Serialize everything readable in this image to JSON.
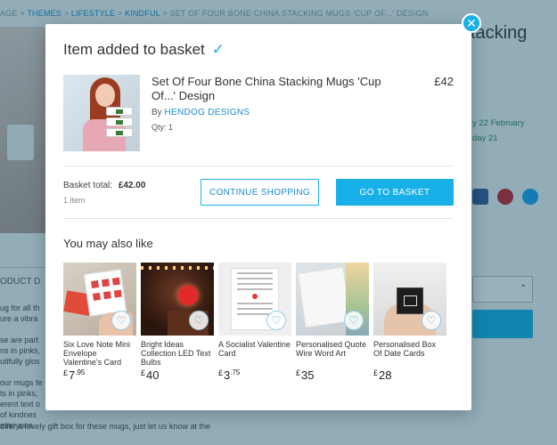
{
  "background": {
    "breadcrumb": [
      "AGE",
      "THEMES",
      "LIFESTYLE",
      "KINDFUL",
      "SET OF FOUR BONE CHINA STACKING MUGS 'CUP OF...' DESIGN"
    ],
    "title_fragment": "tacking",
    "delivery_lines": [
      "y 22 February",
      "day 21"
    ],
    "section_fragment": "ODUCT D",
    "para_lines": [
      "ug for all th",
      "ure a vibra",
      "",
      "se are part",
      "ns in pinks,",
      "utifully glos",
      "",
      "our mugs fe",
      "ts in pinks,",
      "erent text o",
      "of kindnes",
      "everyone."
    ],
    "footer_fragment": "offer a lovely gift box for these mugs, just let us know at the"
  },
  "modal": {
    "heading": "Item added to basket",
    "close_label": "✕",
    "item": {
      "name": "Set Of Four Bone China Stacking Mugs 'Cup Of...' Design",
      "by_label": "By",
      "seller": "HENDOG DESIGNS",
      "qty": "Qty: 1",
      "price": "£42"
    },
    "basket": {
      "total_label": "Basket total:",
      "total_value": "£42.00",
      "items_count": "1 item"
    },
    "buttons": {
      "continue": "CONTINUE SHOPPING",
      "basket": "GO TO BASKET"
    },
    "also_title": "You may also like",
    "recommendations": [
      {
        "name": "Six Love Note Mini Envelope Valentine's Card",
        "currency": "£",
        "price_main": "7",
        "price_pence": ".95"
      },
      {
        "name": "Bright Ideas Collection LED Text Bulbs",
        "currency": "£",
        "price_main": "40",
        "price_pence": ""
      },
      {
        "name": "A Socialist Valentine Card",
        "currency": "£",
        "price_main": "3",
        "price_pence": ".75"
      },
      {
        "name": "Personalised Quote Wire Word Art",
        "currency": "£",
        "price_main": "35",
        "price_pence": ""
      },
      {
        "name": "Personalised Box Of Date Cards",
        "currency": "£",
        "price_main": "28",
        "price_pence": ""
      }
    ]
  },
  "colors": {
    "accent": "#19b0e9",
    "link": "#1b8bd0",
    "overlay": "#094862"
  },
  "icons": {
    "check": "check-icon",
    "close": "close-icon",
    "heart": "heart-icon"
  }
}
